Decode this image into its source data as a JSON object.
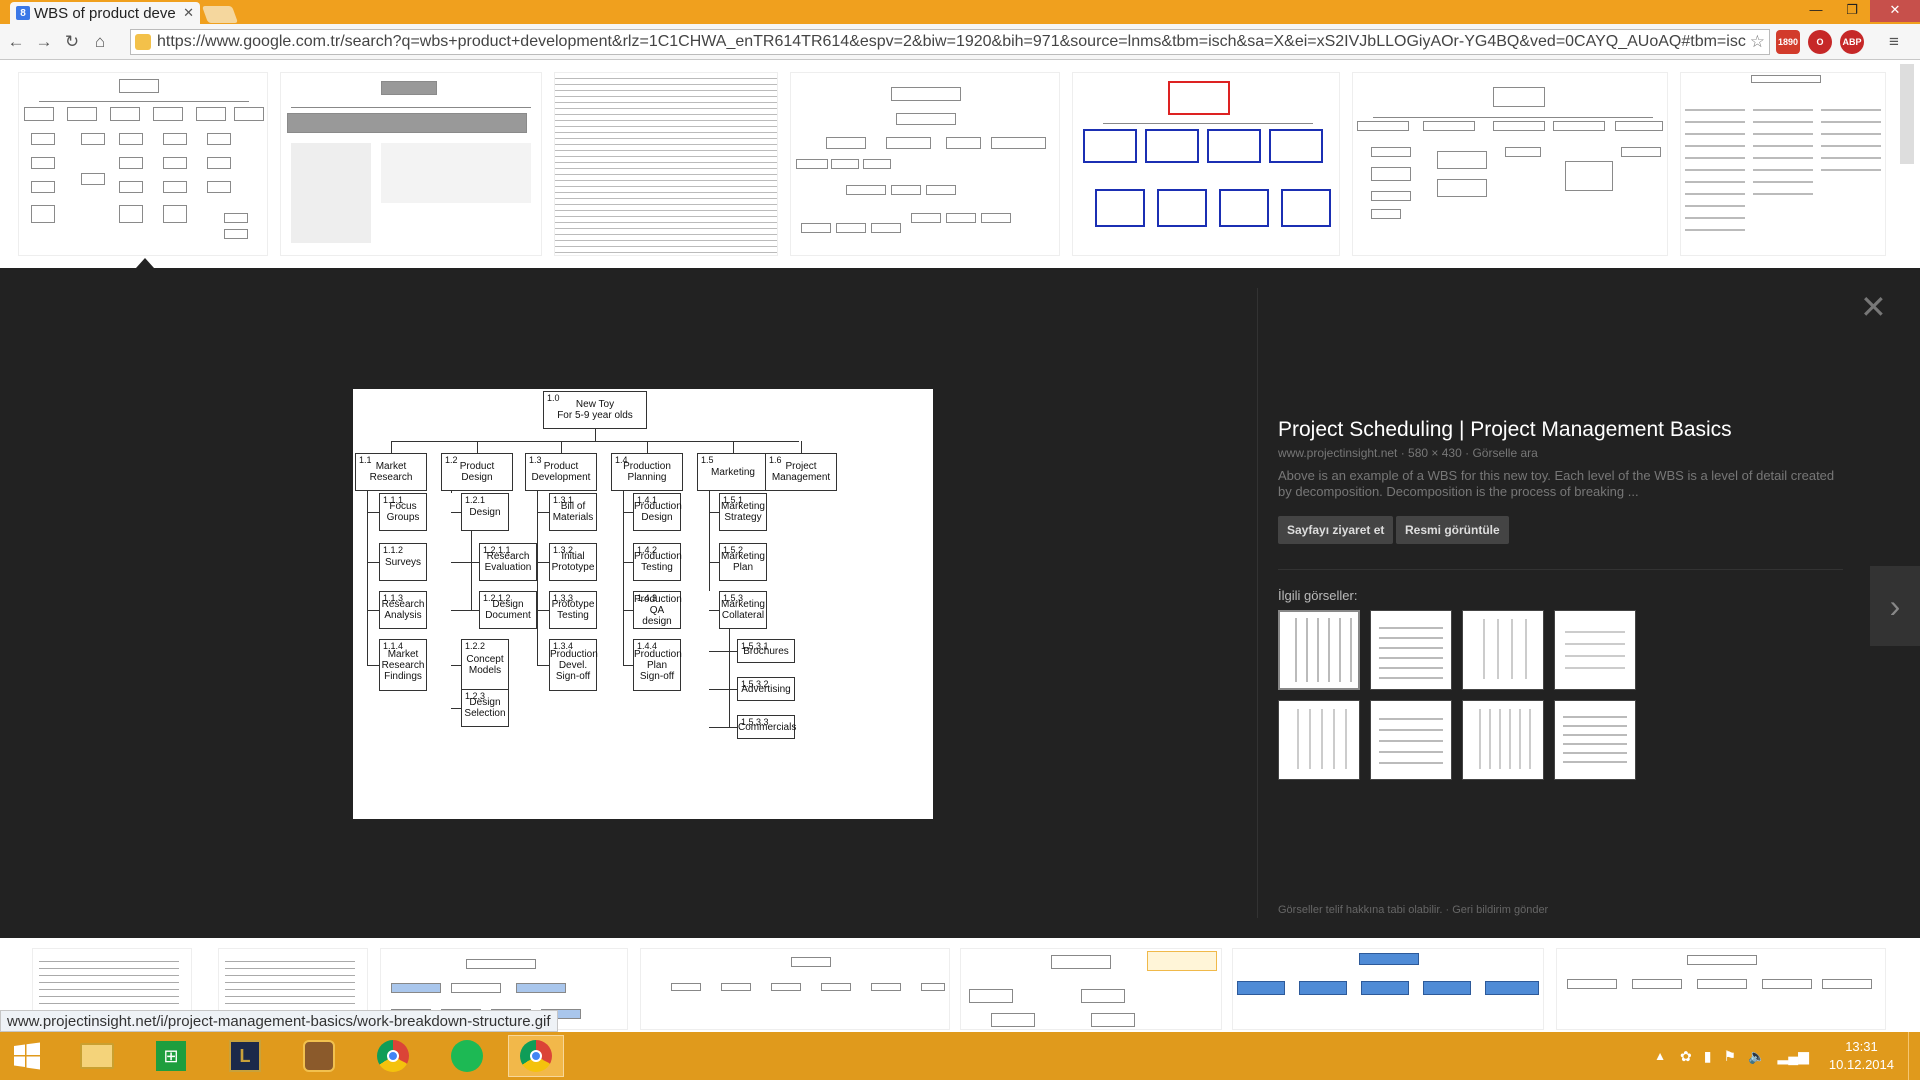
{
  "browser": {
    "tab_title": "WBS of product deve",
    "url": "https://www.google.com.tr/search?q=wbs+product+development&rlz=1C1CHWA_enTR614TR614&espv=2&biw=1920&bih=971&source=lnms&tbm=isch&sa=X&ei=xS2IVJbLLOGiyAOr-YG4BQ&ved=0CAYQ_AUoAQ#tbm=isch&q",
    "status_url": "www.projectinsight.net/i/project-management-basics/work-breakdown-structure.gif",
    "ext_badge": "1890"
  },
  "preview": {
    "title": "Project Scheduling | Project Management Basics",
    "meta": "www.projectinsight.net · 580 × 430 · Görselle ara",
    "description": "Above is an example of a WBS for this new toy. Each level of the WBS is a level of detail created by decomposition. Decomposition is the process of breaking ...",
    "visit_button": "Sayfayı ziyaret et",
    "view_button": "Resmi görüntüle",
    "related_label": "İlgili görseller:",
    "copyright": "Görseller telif hakkına tabi olabilir. · Geri bildirim gönder"
  },
  "wbs": {
    "root": {
      "num": "1.0",
      "text": "New Toy\nFor 5-9 year olds"
    },
    "level1": [
      {
        "num": "1.1",
        "text": "Market\nResearch"
      },
      {
        "num": "1.2",
        "text": "Product\nDesign"
      },
      {
        "num": "1.3",
        "text": "Product\nDevelopment"
      },
      {
        "num": "1.4",
        "text": "Production\nPlanning"
      },
      {
        "num": "1.5",
        "text": "Marketing"
      },
      {
        "num": "1.6",
        "text": "Project\nManagement"
      }
    ],
    "col1": [
      {
        "num": "1.1.1",
        "text": "Focus\nGroups"
      },
      {
        "num": "1.1.2",
        "text": "Surveys"
      },
      {
        "num": "1.1.3",
        "text": "Research\nAnalysis"
      },
      {
        "num": "1.1.4",
        "text": "Market\nResearch\nFindings"
      }
    ],
    "col2": [
      {
        "num": "1.2.1",
        "text": "Design"
      },
      {
        "num": "1.2.1.1",
        "text": "Research\nEvaluation"
      },
      {
        "num": "1.2.1.2",
        "text": "Design\nDocument"
      },
      {
        "num": "1.2.2",
        "text": "Concept\nModels"
      },
      {
        "num": "1.2.3",
        "text": "Design\nSelection"
      }
    ],
    "col3": [
      {
        "num": "1.3.1",
        "text": "Bill of\nMaterials"
      },
      {
        "num": "1.3.2",
        "text": "Initial\nPrototype"
      },
      {
        "num": "1.3.3",
        "text": "Prototype\nTesting"
      },
      {
        "num": "1.3.4",
        "text": "Production\nDevel.\nSign-off"
      }
    ],
    "col4": [
      {
        "num": "1.4.1",
        "text": "Production\nDesign"
      },
      {
        "num": "1.4.2",
        "text": "Production\nTesting"
      },
      {
        "num": "1.4.3",
        "text": "Production\nQA design"
      },
      {
        "num": "1.4.4",
        "text": "Production\nPlan\nSign-off"
      }
    ],
    "col5": [
      {
        "num": "1.5.1",
        "text": "Marketing\nStrategy"
      },
      {
        "num": "1.5.2",
        "text": "Marketing\nPlan"
      },
      {
        "num": "1.5.3",
        "text": "Marketing\nCollateral"
      },
      {
        "num": "1.5.3.1",
        "text": "Brochures"
      },
      {
        "num": "1.5.3.2",
        "text": "Advertising"
      },
      {
        "num": "1.5.3.3",
        "text": "Commercials"
      }
    ]
  },
  "taskbar": {
    "time": "13:31",
    "date": "10.12.2014"
  },
  "colors": {
    "chrome_frame": "#f0a01e",
    "taskbar": "#e09a1c",
    "lightbox_bg": "#222222"
  }
}
